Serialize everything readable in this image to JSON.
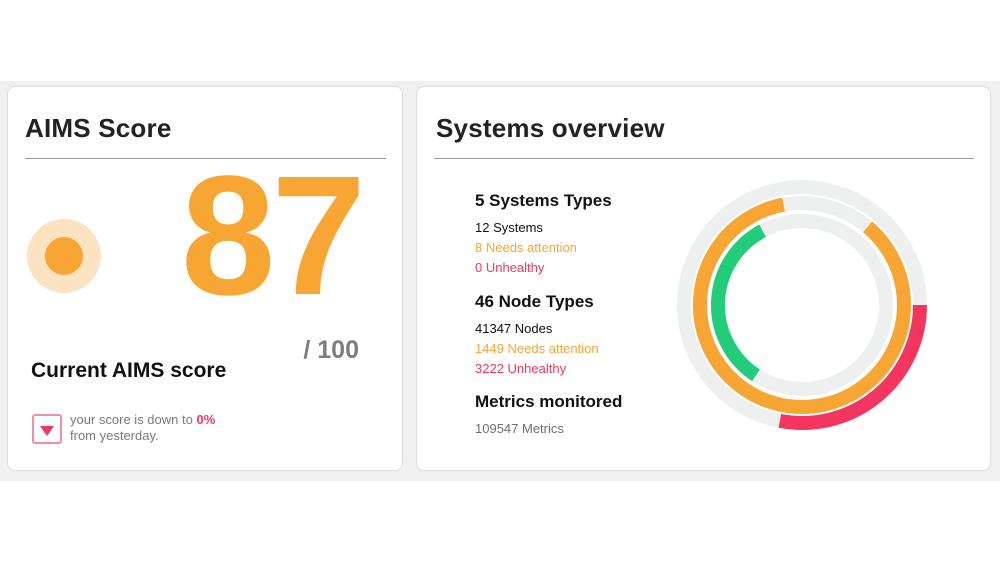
{
  "aims": {
    "title": "AIMS Score",
    "score": "87",
    "out_of": "/ 100",
    "score_label": "Current AIMS score",
    "trend_text": "your score is down to",
    "trend_pct": "0%",
    "trend_suffix": "from yesterday.",
    "score_value": 87,
    "colors": {
      "accent": "#f7a533",
      "accent_light": "#fbe3c1",
      "down": "#f4365f"
    }
  },
  "overview": {
    "title": "Systems overview",
    "systems": {
      "heading": "5 Systems Types",
      "count": "12 Systems",
      "attention": "8 Needs attention",
      "unhealthy": "0 Unhealthy"
    },
    "nodes": {
      "heading": "46 Node Types",
      "count": "41347 Nodes",
      "attention": "1449 Needs attention",
      "unhealthy": "3222 Unhealthy"
    },
    "metrics": {
      "heading": "Metrics monitored",
      "count": "109547 Metrics"
    },
    "rings": [
      {
        "name": "unhealthy",
        "color": "#f4365f",
        "fraction": 0.28
      },
      {
        "name": "needs-attention",
        "color": "#f7a533",
        "fraction": 0.86
      },
      {
        "name": "healthy",
        "color": "#21cc7a",
        "fraction": 0.33
      }
    ],
    "colors": {
      "track": "#eef0f0",
      "attention": "#f7a533",
      "unhealthy": "#f4365f",
      "healthy": "#21cc7a"
    }
  }
}
